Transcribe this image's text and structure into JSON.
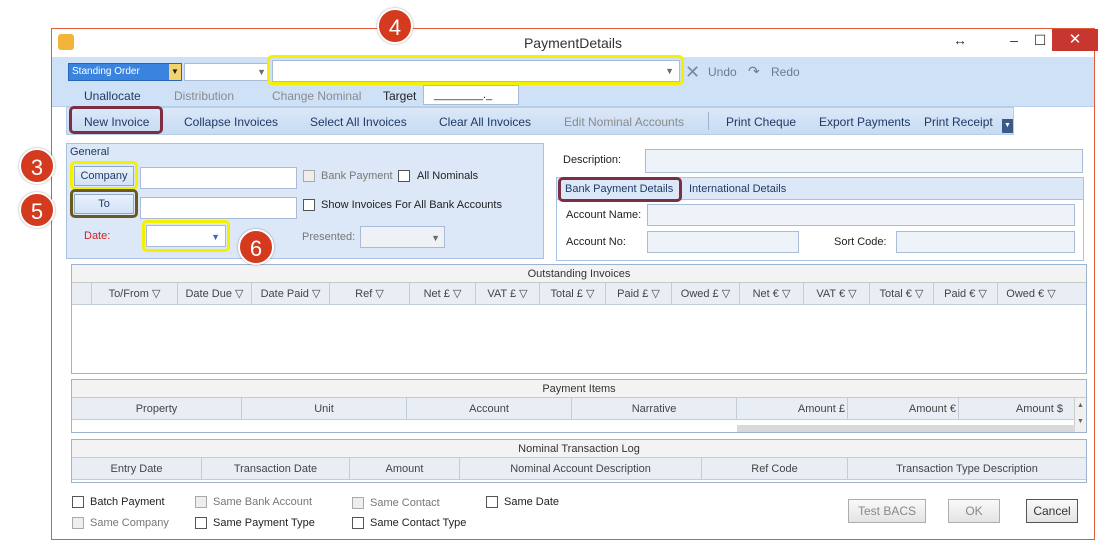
{
  "window": {
    "title": "PaymentDetails"
  },
  "toolbar": {
    "type_value": "Standing Order",
    "undo": "Undo",
    "redo": "Redo",
    "unallocate": "Unallocate",
    "distribution": "Distribution",
    "change_nominal": "Change Nominal",
    "target_label": "Target",
    "target_value": "________._"
  },
  "ribbon": {
    "items": [
      "New Invoice",
      "Collapse Invoices",
      "Select All Invoices",
      "Clear All Invoices",
      "Edit Nominal Accounts",
      "Print Cheque",
      "Export Payments",
      "Print Receipt"
    ]
  },
  "general": {
    "header": "General",
    "company_btn": "Company",
    "to_btn": "To",
    "date_label": "Date:",
    "bank_payment": "Bank Payment",
    "all_nominals": "All Nominals",
    "show_invoices": "Show Invoices For All Bank Accounts",
    "presented_label": "Presented:"
  },
  "details": {
    "description_label": "Description:",
    "tabs": [
      "Bank Payment Details",
      "International Details"
    ],
    "account_name_label": "Account Name:",
    "account_no_label": "Account No:",
    "sort_code_label": "Sort Code:"
  },
  "outstanding": {
    "title": "Outstanding Invoices",
    "columns": [
      "To/From",
      "Date Due",
      "Date Paid",
      "Ref",
      "Net £",
      "VAT £",
      "Total £",
      "Paid £",
      "Owed £",
      "Net €",
      "VAT €",
      "Total €",
      "Paid €",
      "Owed €"
    ]
  },
  "payment_items": {
    "title": "Payment Items",
    "columns": [
      "Property",
      "Unit",
      "Account",
      "Narrative",
      "Amount £",
      "Amount €",
      "Amount $"
    ]
  },
  "nominal_log": {
    "title": "Nominal Transaction Log",
    "columns": [
      "Entry Date",
      "Transaction Date",
      "Amount",
      "Nominal Account Description",
      "Ref Code",
      "Transaction Type Description"
    ]
  },
  "footer": {
    "batch_payment": "Batch Payment",
    "same_company": "Same Company",
    "same_bank_account": "Same Bank Account",
    "same_payment_type": "Same Payment Type",
    "same_contact": "Same Contact",
    "same_contact_type": "Same Contact Type",
    "same_date": "Same Date",
    "test_bacs": "Test BACS",
    "ok": "OK",
    "cancel": "Cancel"
  },
  "badges": [
    "3",
    "4",
    "5",
    "6"
  ],
  "colors": {
    "highlight_yellow": "#f3f000",
    "highlight_maroon": "#7c2f43",
    "badge_red": "#d33a1e",
    "panel_blue": "#dce8f7"
  }
}
